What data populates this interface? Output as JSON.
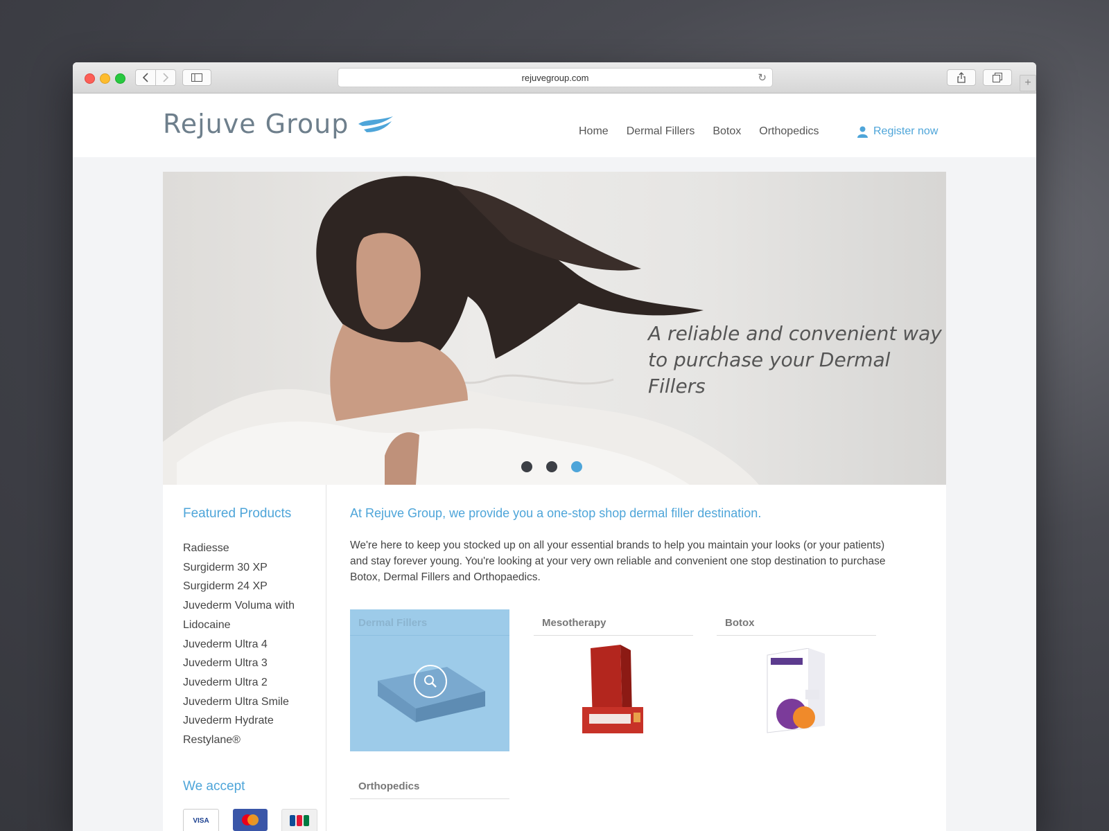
{
  "browser": {
    "url": "rejuvegroup.com"
  },
  "site": {
    "logo_text": "Rejuve Group",
    "nav": [
      "Home",
      "Dermal Fillers",
      "Botox",
      "Orthopedics"
    ],
    "register_label": "Register now"
  },
  "hero": {
    "tagline_line1": "A reliable and convenient way",
    "tagline_line2": "to purchase your Dermal Fillers",
    "slide_count": 3,
    "active_slide": 3
  },
  "sidebar": {
    "featured_title": "Featured Products",
    "products": [
      "Radiesse",
      "Surgiderm 30 XP",
      "Surgiderm 24 XP",
      "Juvederm Voluma with Lidocaine",
      "Juvederm Ultra 4",
      "Juvederm Ultra 3",
      "Juvederm Ultra 2",
      "Juvederm Ultra Smile",
      "Juvederm Hydrate",
      "Restylane®"
    ],
    "accept_title": "We accept",
    "cards": [
      "VISA",
      "mastercard",
      "JCB"
    ]
  },
  "main": {
    "title": "At Rejuve Group, we provide you a one-stop shop dermal filler destination.",
    "text": "We're here to keep you stocked up on all your essential brands to help you maintain your looks (or your patients) and stay forever young. You're looking at your very own reliable and convenient one stop destination to purchase Botox, Dermal Fillers and Orthopaedics.",
    "categories": [
      "Dermal Fillers",
      "Mesotherapy",
      "Botox",
      "Orthopedics"
    ]
  },
  "colors": {
    "accent": "#4ea5d9",
    "hover_overlay": "#9dcbe9"
  }
}
